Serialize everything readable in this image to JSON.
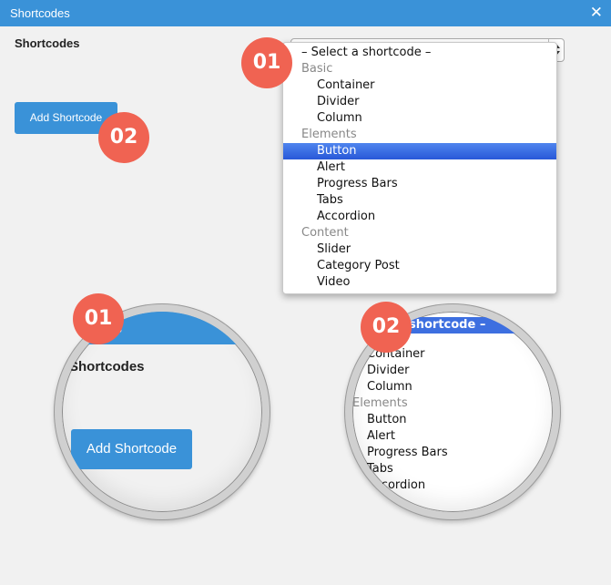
{
  "window": {
    "title": "Shortcodes",
    "close_glyph": "✕"
  },
  "form": {
    "label": "Shortcodes",
    "select_value": "– Select a shortcode –",
    "options": [
      {
        "label": "– Select a shortcode –",
        "type": "option"
      },
      {
        "label": "Basic",
        "type": "group"
      },
      {
        "label": "Container",
        "type": "option"
      },
      {
        "label": "Divider",
        "type": "option"
      },
      {
        "label": "Column",
        "type": "option"
      },
      {
        "label": "Elements",
        "type": "group"
      },
      {
        "label": "Button",
        "type": "option",
        "selected": true
      },
      {
        "label": "Alert",
        "type": "option"
      },
      {
        "label": "Progress Bars",
        "type": "option"
      },
      {
        "label": "Tabs",
        "type": "option"
      },
      {
        "label": "Accordion",
        "type": "option"
      },
      {
        "label": "Content",
        "type": "group"
      },
      {
        "label": "Slider",
        "type": "option"
      },
      {
        "label": "Category Post",
        "type": "option"
      },
      {
        "label": "Video",
        "type": "option"
      }
    ],
    "add_button": "Add Shortcode"
  },
  "badges": {
    "one": "01",
    "two": "02"
  },
  "zoom1": {
    "bar_text": "es",
    "label": "Shortcodes",
    "button": "Add Shortcode"
  },
  "zoom2": {
    "top_text": "shortcode –",
    "items": [
      {
        "label": "Container",
        "type": "option"
      },
      {
        "label": "Divider",
        "type": "option"
      },
      {
        "label": "Column",
        "type": "option"
      },
      {
        "label": "Elements",
        "type": "group"
      },
      {
        "label": "Button",
        "type": "option"
      },
      {
        "label": "Alert",
        "type": "option"
      },
      {
        "label": "Progress Bars",
        "type": "option"
      },
      {
        "label": "Tabs",
        "type": "option"
      },
      {
        "label": "Accordion",
        "type": "option"
      }
    ]
  },
  "colors": {
    "accent": "#3a92d8",
    "badge": "#f06352",
    "selected": "#3d6fe0",
    "background": "#f1f1f1"
  }
}
